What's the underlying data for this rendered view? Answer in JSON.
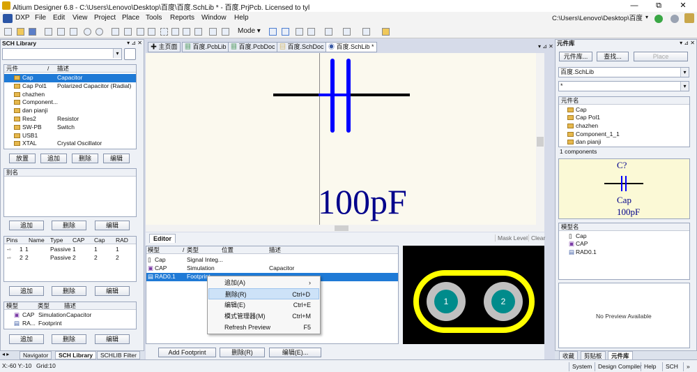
{
  "window": {
    "title": "Altium Designer 6.8 - C:\\Users\\Lenovo\\Desktop\\百度\\百度.SchLib * - 百度.PrjPcb. Licensed to tyl",
    "controls": [
      "—",
      "⧉",
      "✕"
    ]
  },
  "menu": {
    "items": [
      "DXP",
      "File",
      "Edit",
      "View",
      "Project",
      "Place",
      "Tools",
      "Reports",
      "Window",
      "Help"
    ],
    "path": "C:\\Users\\Lenovo\\Desktop\\百度"
  },
  "toolbar": {
    "mode_label": "Mode"
  },
  "sch_library": {
    "title": "SCH Library",
    "components_header": {
      "col1": "元件",
      "col2": "描述"
    },
    "components": [
      {
        "name": "Cap",
        "desc": "Capacitor",
        "selected": true
      },
      {
        "name": "Cap Pol1",
        "desc": "Polarized Capacitor (Radial)"
      },
      {
        "name": "chazhen",
        "desc": ""
      },
      {
        "name": "Component...",
        "desc": ""
      },
      {
        "name": "dan pianji",
        "desc": ""
      },
      {
        "name": "Res2",
        "desc": "Resistor"
      },
      {
        "name": "SW-PB",
        "desc": "Switch"
      },
      {
        "name": "USB1",
        "desc": ""
      },
      {
        "name": "XTAL",
        "desc": "Crystal Oscillator"
      }
    ],
    "comp_buttons": [
      "放置",
      "追加",
      "删除",
      "编辑"
    ],
    "alias_header": "别名",
    "alias_buttons": [
      "追加",
      "删除",
      "编辑"
    ],
    "pins_header": [
      "Pins",
      "Name",
      "Type",
      "CAP",
      "Cap",
      "RAD"
    ],
    "pins": [
      {
        "pin": "1",
        "name": "1",
        "type": "Passive",
        "cap1": "1",
        "cap2": "1",
        "rad": "1"
      },
      {
        "pin": "2",
        "name": "2",
        "type": "Passive",
        "cap1": "2",
        "cap2": "2",
        "rad": "2"
      }
    ],
    "pin_buttons": [
      "追加",
      "删除",
      "编辑"
    ],
    "model_header": [
      "模型",
      "类型",
      "描述"
    ],
    "models": [
      {
        "name": "CAP",
        "type": "Simulation",
        "desc": "Capacitor"
      },
      {
        "name": "RA...",
        "type": "Footprint",
        "desc": ""
      }
    ],
    "model_buttons": [
      "追加",
      "删除",
      "编辑"
    ]
  },
  "bottom_tabs": [
    "Navigator",
    "SCH Library",
    "SCHLIB Filter"
  ],
  "doc_tabs": [
    "主页面",
    "百度.PcbLib",
    "百度.PcbDoc",
    "百度.SchDoc",
    "百度.SchLib *"
  ],
  "schematic": {
    "value_text": "100pF"
  },
  "editor": {
    "tab": "Editor",
    "mask_level": "Mask Level",
    "clear": "Clear",
    "header": [
      "模型",
      "类型",
      "位置",
      "描述"
    ],
    "rows": [
      {
        "model": "Cap",
        "type": "Signal Integ...",
        "loc": "",
        "desc": ""
      },
      {
        "model": "CAP",
        "type": "Simulation",
        "loc": "",
        "desc": "Capacitor"
      },
      {
        "model": "RAD0.1",
        "type": "Footprint",
        "loc": "",
        "desc": "",
        "selected": true
      }
    ],
    "buttons": [
      "Add Footprint",
      "删除(R)",
      "编辑(E)..."
    ],
    "pads": [
      "1",
      "2"
    ]
  },
  "context_menu": [
    {
      "label": "追加(A)",
      "shortcut": "",
      "submenu": true
    },
    {
      "label": "删除(R)",
      "shortcut": "Ctrl+D",
      "highlight": true
    },
    {
      "label": "编辑(E)",
      "shortcut": "Ctrl+E"
    },
    {
      "label": "模式管理器(M)",
      "shortcut": "Ctrl+M"
    },
    {
      "label": "Refresh Preview",
      "shortcut": "F5"
    }
  ],
  "libraries": {
    "title": "元件库",
    "buttons": [
      "元件库...",
      "查找...",
      "Place"
    ],
    "lib_select": "百度.SchLib",
    "filter": "*",
    "comp_header": "元件名",
    "components": [
      "Cap",
      "Cap Pol1",
      "chazhen",
      "Component_1_1",
      "dan pianji"
    ],
    "count": "1 components",
    "preview": {
      "designator": "C?",
      "name": "Cap",
      "value": "100pF"
    },
    "model_header": "模型名",
    "models": [
      "Cap",
      "CAP",
      "RAD0.1"
    ],
    "no_preview": "No Preview Available",
    "bottom_tabs": [
      "收藏",
      "剪贴板",
      "元件库"
    ]
  },
  "status": {
    "coords": "X:-60 Y:-10",
    "grid": "Grid:10",
    "tabs": [
      "System",
      "Design Compiler",
      "Help",
      "SCH",
      "»"
    ]
  },
  "colors": {
    "accent": "#1f7ad6",
    "schematic_blue": "#0000ff",
    "pcb_yellow": "#ffff00",
    "pad_teal": "#008b8b"
  }
}
